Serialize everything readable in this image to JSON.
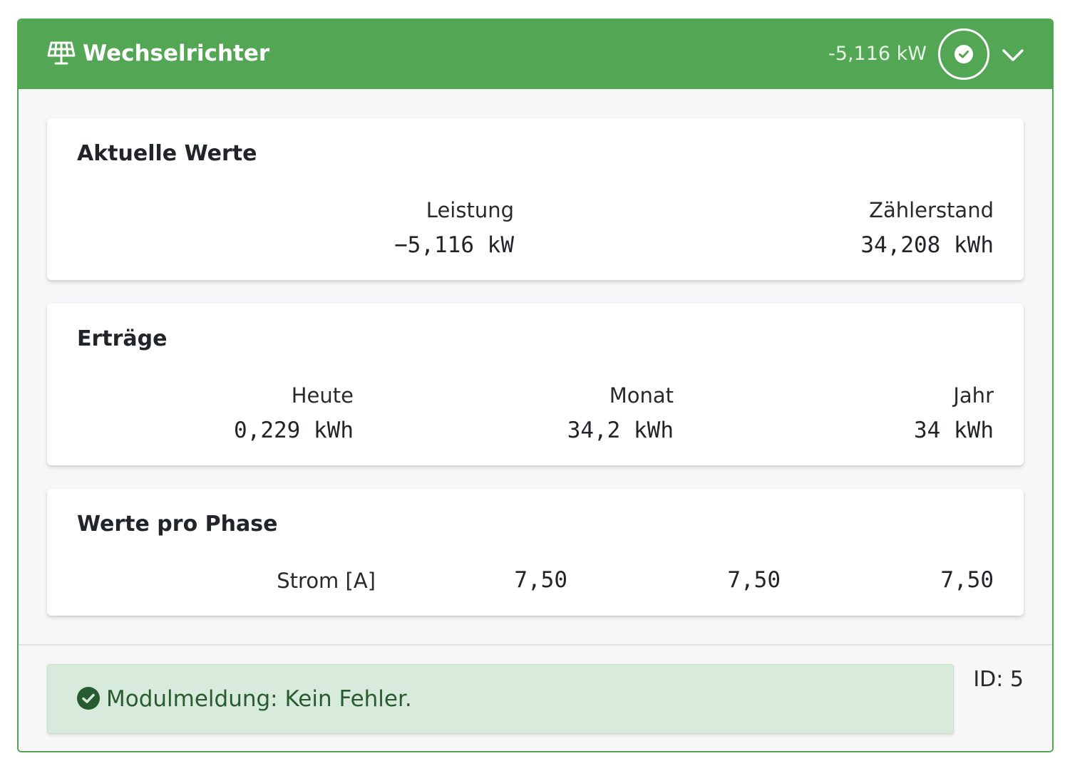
{
  "header": {
    "title": "Wechselrichter",
    "power": "-5,116 kW",
    "icon": "solar-panel-icon",
    "status_icon": "check-circle-icon",
    "toggle_icon": "chevron-down-icon",
    "color": "#53a653"
  },
  "current_values": {
    "title": "Aktuelle Werte",
    "power_label": "Leistung",
    "power_value": "−5,116 kW",
    "meter_label": "Zählerstand",
    "meter_value": "34,208 kWh"
  },
  "yields": {
    "title": "Erträge",
    "today_label": "Heute",
    "today_value": "0,229 kWh",
    "month_label": "Monat",
    "month_value": "34,2 kWh",
    "year_label": "Jahr",
    "year_value": "34 kWh"
  },
  "phases": {
    "title": "Werte pro Phase",
    "current_label": "Strom [A]",
    "values": [
      "7,50",
      "7,50",
      "7,50"
    ]
  },
  "footer": {
    "message": "Modulmeldung: Kein Fehler.",
    "message_icon": "check-circle-icon",
    "id": "ID: 5",
    "alert_color": "#d8eadb"
  }
}
